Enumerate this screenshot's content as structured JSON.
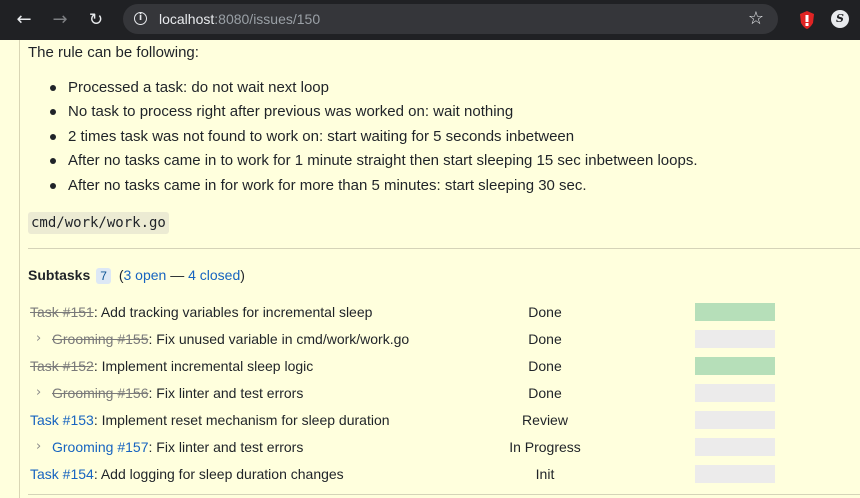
{
  "browser": {
    "url_host": "localhost",
    "url_path": ":8080/issues/150"
  },
  "issue": {
    "rule_intro": "The rule can be following:",
    "rules": [
      "Processed a task: do not wait next loop",
      "No task to process right after previous was worked on: wait nothing",
      "2 times task was not found to work on: start waiting for 5 seconds inbetween",
      "After no tasks came in to work for 1 minute straight then start sleeping 15 sec inbetween loops.",
      "After no tasks came in for work for more than 5 minutes: start sleeping 30 sec."
    ],
    "code_path": "cmd/work/work.go"
  },
  "subtasks": {
    "title": "Subtasks",
    "count": "7",
    "open_label": "3 open",
    "separator": " — ",
    "closed_label": "4 closed",
    "paren_open": "(",
    "paren_close": ")",
    "items": [
      {
        "ref": "Task #151",
        "title": ": Add tracking variables for incremental sleep",
        "status": "Done",
        "progress": 1.0,
        "nested": false,
        "closed": true
      },
      {
        "ref": "Grooming #155",
        "title": ": Fix unused variable in cmd/work/work.go",
        "status": "Done",
        "progress": 0.0,
        "nested": true,
        "closed": true
      },
      {
        "ref": "Task #152",
        "title": ": Implement incremental sleep logic",
        "status": "Done",
        "progress": 1.0,
        "nested": false,
        "closed": true
      },
      {
        "ref": "Grooming #156",
        "title": ": Fix linter and test errors",
        "status": "Done",
        "progress": 0.0,
        "nested": true,
        "closed": true
      },
      {
        "ref": "Task #153",
        "title": ": Implement reset mechanism for sleep duration",
        "status": "Review",
        "progress": 0.0,
        "nested": false,
        "closed": false
      },
      {
        "ref": "Grooming #157",
        "title": ": Fix linter and test errors",
        "status": "In Progress",
        "progress": 0.0,
        "nested": true,
        "closed": false
      },
      {
        "ref": "Task #154",
        "title": ": Add logging for sleep duration changes",
        "status": "Init",
        "progress": 0.0,
        "nested": false,
        "closed": false
      }
    ]
  },
  "colors": {
    "page_bg": "#ffffdd",
    "link": "#1764c0",
    "progress_done": "#b6dfb9",
    "progress_empty": "#ecebeb"
  },
  "icons": [
    "back-arrow-icon",
    "forward-arrow-icon",
    "reload-icon",
    "info-icon",
    "star-icon",
    "chevron-right-icon"
  ]
}
